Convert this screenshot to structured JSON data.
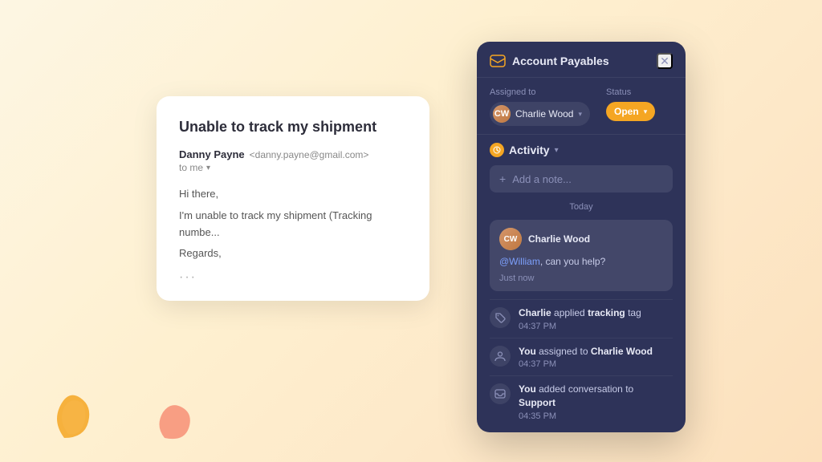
{
  "background": {
    "gradient_start": "#fdf6e3",
    "gradient_end": "#fce0bc"
  },
  "email_card": {
    "title": "Unable to track my shipment",
    "sender_name": "Danny Payne",
    "sender_email": "<danny.payne@gmail.com>",
    "to_label": "to me",
    "body_line1": "Hi there,",
    "body_line2": "I'm unable to track my shipment (Tracking numbe...",
    "body_line3": "Regards,",
    "more_label": "···"
  },
  "panel": {
    "title": "Account Payables",
    "close_label": "✕",
    "assigned_label": "Assigned to",
    "assignee_name": "Charlie Wood",
    "status_label": "Status",
    "status_value": "Open",
    "activity_label": "Activity",
    "add_note_label": "Add a note...",
    "today_label": "Today",
    "comment": {
      "author": "Charlie Wood",
      "mention": "@William",
      "text": ", can you help?",
      "time": "Just now"
    },
    "log_items": [
      {
        "icon": "tag",
        "actor": "Charlie",
        "action": "applied",
        "bold": "tracking",
        "action2": "tag",
        "time": "04:37 PM"
      },
      {
        "icon": "person",
        "actor": "You",
        "action": "assigned to",
        "bold": "Charlie Wood",
        "time": "04:37 PM"
      },
      {
        "icon": "inbox",
        "actor": "You",
        "action": "added conversation to",
        "bold": "Support",
        "time": "04:35 PM"
      }
    ]
  }
}
